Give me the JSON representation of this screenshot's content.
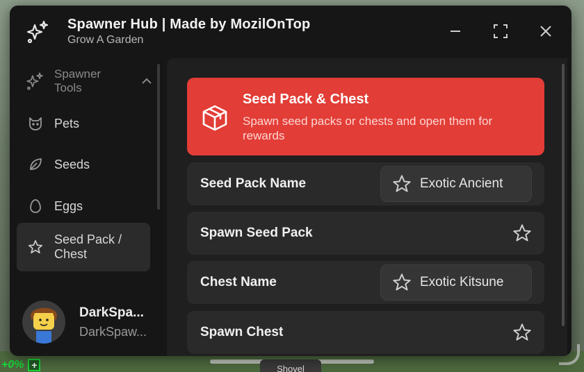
{
  "window": {
    "title": "Spawner Hub | Made by MozilOnTop",
    "subtitle": "Grow A Garden"
  },
  "sidebar": {
    "group": {
      "label": "Spawner Tools",
      "icon": "sparkles-icon"
    },
    "items": [
      {
        "label": "Pets",
        "icon": "cat-icon",
        "active": false
      },
      {
        "label": "Seeds",
        "icon": "leaf-icon",
        "active": false
      },
      {
        "label": "Eggs",
        "icon": "egg-icon",
        "active": false
      },
      {
        "label": "Seed Pack / Chest",
        "icon": "star-icon",
        "active": true
      }
    ],
    "user": {
      "name": "DarkSpa...",
      "handle": "DarkSpaw..."
    }
  },
  "main": {
    "banner": {
      "title": "Seed Pack & Chest",
      "description": "Spawn seed packs or chests and open them for rewards",
      "icon": "package-icon",
      "color": "#e23d36"
    },
    "rows": [
      {
        "label": "Seed Pack Name",
        "type": "dropdown",
        "value": "Exotic Ancient"
      },
      {
        "label": "Spawn Seed Pack",
        "type": "button"
      },
      {
        "label": "Chest Name",
        "type": "dropdown",
        "value": "Exotic Kitsune"
      },
      {
        "label": "Spawn Chest",
        "type": "button"
      }
    ]
  },
  "hud": {
    "stat": "+0%",
    "tool": "Shovel"
  }
}
